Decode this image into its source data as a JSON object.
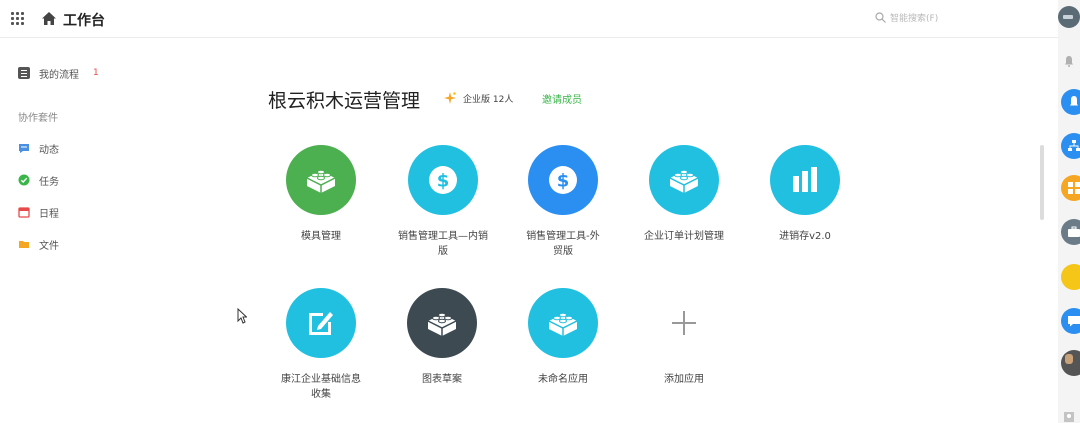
{
  "header": {
    "title": "工作台",
    "search_placeholder": "智能搜索(F)"
  },
  "sidebar": {
    "my_flow": {
      "label": "我的流程",
      "badge": "1"
    },
    "section_title": "协作套件",
    "items": [
      {
        "label": "动态",
        "icon": "chat-icon",
        "color": "#4a90e2"
      },
      {
        "label": "任务",
        "icon": "check-icon",
        "color": "#3bb54a"
      },
      {
        "label": "日程",
        "icon": "calendar-icon",
        "color": "#e84a4a"
      },
      {
        "label": "文件",
        "icon": "folder-icon",
        "color": "#f5a623"
      }
    ]
  },
  "workspace": {
    "title": "根云积木运营管理",
    "edition": "企业版 12人",
    "invite_label": "邀请成员"
  },
  "apps": [
    {
      "name": "模具管理",
      "icon": "brick-icon",
      "color": "#4caf50"
    },
    {
      "name": "销售管理工具—内销版",
      "icon": "dollar-icon",
      "color": "#22c0e0"
    },
    {
      "name": "销售管理工具-外贸版",
      "icon": "dollar-icon",
      "color": "#2b8ff2"
    },
    {
      "name": "企业订单计划管理",
      "icon": "brick-icon",
      "color": "#22c0e0"
    },
    {
      "name": "进销存v2.0",
      "icon": "bar-chart-icon",
      "color": "#22c0e0"
    },
    {
      "name": "康江企业基础信息收集",
      "icon": "edit-icon",
      "color": "#22c0e0"
    },
    {
      "name": "图表草案",
      "icon": "brick-icon",
      "color": "#3d4a52"
    },
    {
      "name": "未命名应用",
      "icon": "brick-icon",
      "color": "#22c0e0"
    },
    {
      "name": "添加应用",
      "icon": "plus-icon",
      "color": "#ffffff"
    }
  ],
  "right_rail": [
    {
      "icon": "bell-icon",
      "color": "#b0b0b0"
    },
    {
      "icon": "bell-icon",
      "color": "#2b8ff2"
    },
    {
      "icon": "org-chart-icon",
      "color": "#2b8ff2"
    },
    {
      "icon": "grid-apps-icon",
      "color": "#f5a623"
    },
    {
      "icon": "briefcase-icon",
      "color": "#6b7c88"
    },
    {
      "icon": "badge-icon",
      "color": "#f5c518"
    },
    {
      "icon": "message-icon",
      "color": "#2b8ff2"
    },
    {
      "icon": "avatar-icon",
      "color": "#555555"
    }
  ]
}
